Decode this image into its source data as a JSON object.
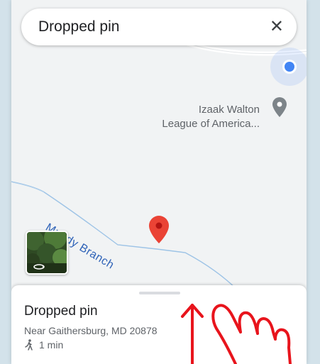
{
  "search": {
    "text": "Dropped pin",
    "close_icon": "✕"
  },
  "map": {
    "poi": {
      "line1": "Izaak Walton",
      "line2": "League of America..."
    },
    "road_label": "Muddy Branch",
    "colors": {
      "map_bg": "#f1f3f4",
      "stream": "#9dc3e6",
      "pin": "#ea4335",
      "location_dot": "#4285f4"
    }
  },
  "sheet": {
    "title": "Dropped pin",
    "address": "Near Gaithersburg, MD 20878",
    "walk_time": "1 min"
  },
  "overlay": {
    "gesture_color": "#e8141c"
  }
}
